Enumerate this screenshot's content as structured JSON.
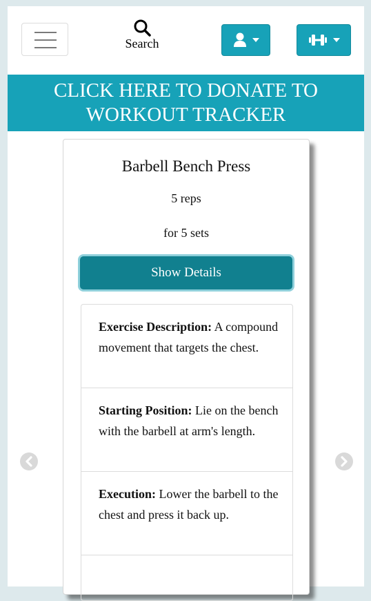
{
  "nav": {
    "menu_icon": "hamburger-menu-icon",
    "search_icon": "search-icon",
    "search_label": "Search",
    "user_icon": "user-icon",
    "workout_icon": "dumbbell-icon",
    "accent_color": "#17a2b8"
  },
  "banner": {
    "text_line1": "CLICK HERE TO DONATE TO",
    "text_line2": "WORKOUT TRACKER"
  },
  "carousel": {
    "prev_icon": "chevron-left-icon",
    "next_icon": "chevron-right-icon"
  },
  "exercise": {
    "name": "Barbell Bench Press",
    "reps": "5 reps",
    "sets": "for 5 sets",
    "details_button": "Show Details",
    "details": [
      {
        "label": "Exercise Description:",
        "text": " A compound movement that targets the chest."
      },
      {
        "label": "Starting Position:",
        "text": " Lie on the bench with the barbell at arm's length."
      },
      {
        "label": "Execution:",
        "text": " Lower the barbell to the chest and press it back up."
      }
    ]
  }
}
